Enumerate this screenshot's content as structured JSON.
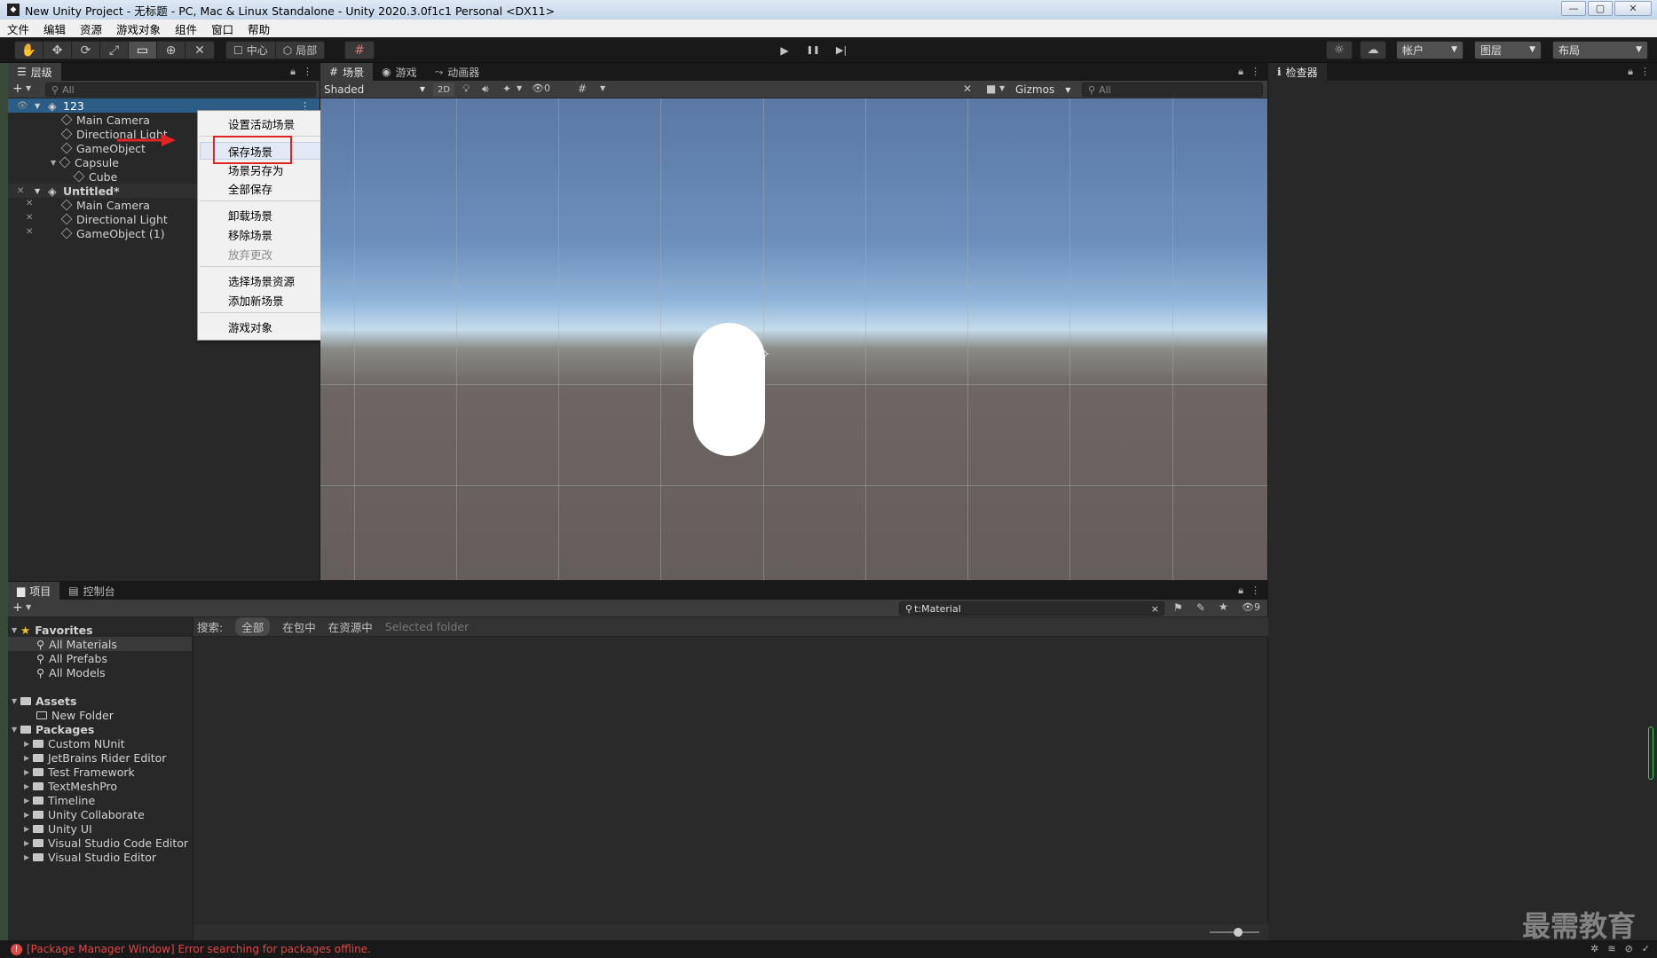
{
  "window": {
    "title": "New Unity Project - 无标题 - PC, Mac & Linux Standalone - Unity 2020.3.0f1c1 Personal <DX11>",
    "icon": "unity-icon",
    "buttons": {
      "minimize": "—",
      "maximize": "▢",
      "close": "✕"
    }
  },
  "menu": [
    "文件",
    "编辑",
    "资源",
    "游戏对象",
    "组件",
    "窗口",
    "帮助"
  ],
  "toolbar": {
    "tools": [
      {
        "name": "hand-tool-icon",
        "glyph": "✋"
      },
      {
        "name": "move-tool-icon",
        "glyph": "✥"
      },
      {
        "name": "rotate-tool-icon",
        "glyph": "⟳"
      },
      {
        "name": "scale-tool-icon",
        "glyph": "⤢"
      },
      {
        "name": "rect-tool-icon",
        "glyph": "▭"
      },
      {
        "name": "transform-tool-icon",
        "glyph": "⊕"
      },
      {
        "name": "custom-tool-icon",
        "glyph": "✕"
      }
    ],
    "pivot": "中心",
    "space": "局部",
    "grid_icon": "#",
    "play": "▶",
    "pause": "❚❚",
    "step": "▶|",
    "account": "帐户",
    "layers": "图层",
    "layout": "布局"
  },
  "hierarchy": {
    "tab": "层级",
    "search_placeholder": "All",
    "add": "+",
    "scene1": {
      "name": "123",
      "children": [
        "Main Camera",
        "Directional Light",
        "GameObject",
        "Capsule",
        "Cube"
      ]
    },
    "scene2": {
      "name": "Untitled*",
      "children": [
        "Main Camera",
        "Directional Light",
        "GameObject (1)"
      ]
    }
  },
  "context_menu": {
    "items": [
      "设置活动场景",
      "保存场景",
      "场景另存为",
      "全部保存",
      "卸载场景",
      "移除场景",
      "放弃更改",
      "选择场景资源",
      "添加新场景",
      "游戏对象"
    ],
    "disabled": "放弃更改",
    "submenu_arrow": "▶"
  },
  "scene_view": {
    "tabs": [
      "场景",
      "游戏",
      "动画器"
    ],
    "shading": "Shaded",
    "mode2d": "2D",
    "hidden_count": "0",
    "gizmos": "Gizmos",
    "search_placeholder": "All"
  },
  "inspector": {
    "tab": "检查器"
  },
  "project": {
    "tabs": [
      "项目",
      "控制台"
    ],
    "add": "+",
    "search_value": "t:Material",
    "hidden_count": "9",
    "favorites_label": "Favorites",
    "favorites": [
      "All Materials",
      "All Prefabs",
      "All Models"
    ],
    "assets_label": "Assets",
    "assets": [
      "New Folder"
    ],
    "packages_label": "Packages",
    "packages": [
      "Custom NUnit",
      "JetBrains Rider Editor",
      "Test Framework",
      "TextMeshPro",
      "Timeline",
      "Unity Collaborate",
      "Unity UI",
      "Visual Studio Code Editor",
      "Visual Studio Editor"
    ],
    "filter": {
      "label": "搜索:",
      "all": "全部",
      "in_packages": "在包中",
      "in_assets": "在资源中",
      "selected_folder": "Selected folder"
    }
  },
  "status": {
    "message": "[Package Manager Window] Error searching for packages offline."
  },
  "watermark": "最需教育",
  "colors": {
    "selection": "#2c5d87",
    "highlight_box": "#e02424",
    "arrow": "#e02424"
  }
}
